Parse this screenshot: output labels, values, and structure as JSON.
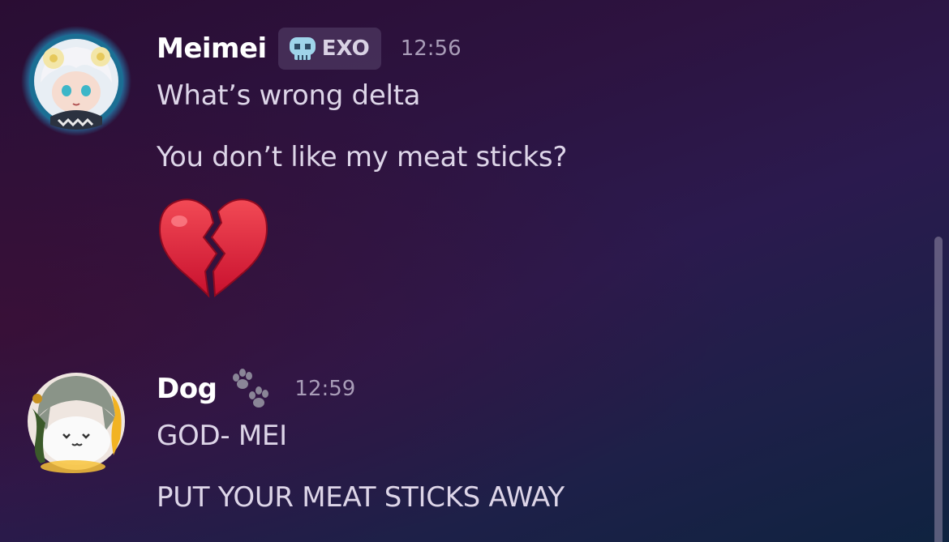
{
  "messages": [
    {
      "username": "Meimei",
      "tag": {
        "icon": "skull-icon",
        "label": "EXO"
      },
      "timestamp": "12:56",
      "lines": [
        "What’s wrong delta",
        "You don’t like my meat sticks?"
      ],
      "emoji": "broken-heart-icon"
    },
    {
      "username": "Dog",
      "name_decoration": "paw-prints-icon",
      "timestamp": "12:59",
      "lines": [
        "GOD- MEI",
        "PUT YOUR MEAT STICKS AWAY"
      ]
    }
  ],
  "colors": {
    "username": "#ffffff",
    "message_text": "#ddd5e8",
    "timestamp": "#a99db8",
    "heart": "#e0283a"
  }
}
